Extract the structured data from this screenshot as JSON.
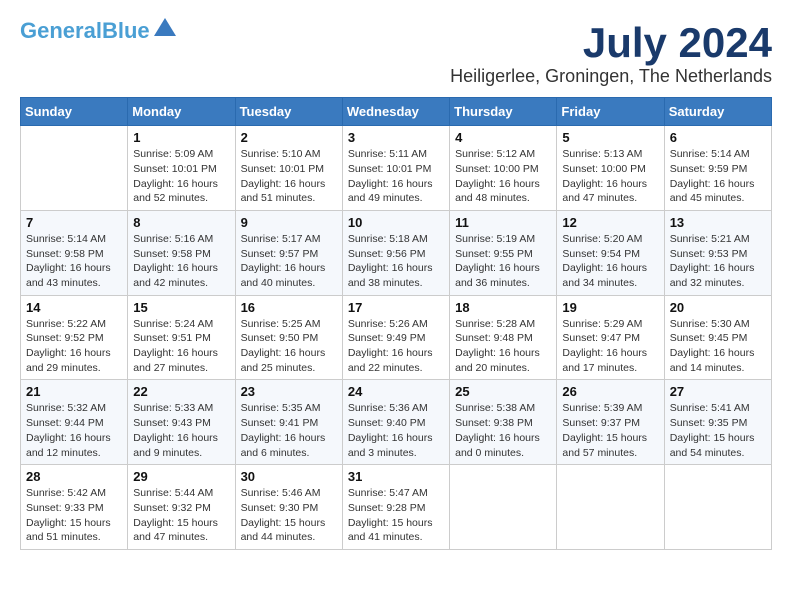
{
  "logo": {
    "line1": "General",
    "line2": "Blue"
  },
  "title": {
    "month": "July 2024",
    "location": "Heiligerlee, Groningen, The Netherlands"
  },
  "header_days": [
    "Sunday",
    "Monday",
    "Tuesday",
    "Wednesday",
    "Thursday",
    "Friday",
    "Saturday"
  ],
  "weeks": [
    [
      {
        "day": "",
        "info": ""
      },
      {
        "day": "1",
        "info": "Sunrise: 5:09 AM\nSunset: 10:01 PM\nDaylight: 16 hours\nand 52 minutes."
      },
      {
        "day": "2",
        "info": "Sunrise: 5:10 AM\nSunset: 10:01 PM\nDaylight: 16 hours\nand 51 minutes."
      },
      {
        "day": "3",
        "info": "Sunrise: 5:11 AM\nSunset: 10:01 PM\nDaylight: 16 hours\nand 49 minutes."
      },
      {
        "day": "4",
        "info": "Sunrise: 5:12 AM\nSunset: 10:00 PM\nDaylight: 16 hours\nand 48 minutes."
      },
      {
        "day": "5",
        "info": "Sunrise: 5:13 AM\nSunset: 10:00 PM\nDaylight: 16 hours\nand 47 minutes."
      },
      {
        "day": "6",
        "info": "Sunrise: 5:14 AM\nSunset: 9:59 PM\nDaylight: 16 hours\nand 45 minutes."
      }
    ],
    [
      {
        "day": "7",
        "info": "Sunrise: 5:14 AM\nSunset: 9:58 PM\nDaylight: 16 hours\nand 43 minutes."
      },
      {
        "day": "8",
        "info": "Sunrise: 5:16 AM\nSunset: 9:58 PM\nDaylight: 16 hours\nand 42 minutes."
      },
      {
        "day": "9",
        "info": "Sunrise: 5:17 AM\nSunset: 9:57 PM\nDaylight: 16 hours\nand 40 minutes."
      },
      {
        "day": "10",
        "info": "Sunrise: 5:18 AM\nSunset: 9:56 PM\nDaylight: 16 hours\nand 38 minutes."
      },
      {
        "day": "11",
        "info": "Sunrise: 5:19 AM\nSunset: 9:55 PM\nDaylight: 16 hours\nand 36 minutes."
      },
      {
        "day": "12",
        "info": "Sunrise: 5:20 AM\nSunset: 9:54 PM\nDaylight: 16 hours\nand 34 minutes."
      },
      {
        "day": "13",
        "info": "Sunrise: 5:21 AM\nSunset: 9:53 PM\nDaylight: 16 hours\nand 32 minutes."
      }
    ],
    [
      {
        "day": "14",
        "info": "Sunrise: 5:22 AM\nSunset: 9:52 PM\nDaylight: 16 hours\nand 29 minutes."
      },
      {
        "day": "15",
        "info": "Sunrise: 5:24 AM\nSunset: 9:51 PM\nDaylight: 16 hours\nand 27 minutes."
      },
      {
        "day": "16",
        "info": "Sunrise: 5:25 AM\nSunset: 9:50 PM\nDaylight: 16 hours\nand 25 minutes."
      },
      {
        "day": "17",
        "info": "Sunrise: 5:26 AM\nSunset: 9:49 PM\nDaylight: 16 hours\nand 22 minutes."
      },
      {
        "day": "18",
        "info": "Sunrise: 5:28 AM\nSunset: 9:48 PM\nDaylight: 16 hours\nand 20 minutes."
      },
      {
        "day": "19",
        "info": "Sunrise: 5:29 AM\nSunset: 9:47 PM\nDaylight: 16 hours\nand 17 minutes."
      },
      {
        "day": "20",
        "info": "Sunrise: 5:30 AM\nSunset: 9:45 PM\nDaylight: 16 hours\nand 14 minutes."
      }
    ],
    [
      {
        "day": "21",
        "info": "Sunrise: 5:32 AM\nSunset: 9:44 PM\nDaylight: 16 hours\nand 12 minutes."
      },
      {
        "day": "22",
        "info": "Sunrise: 5:33 AM\nSunset: 9:43 PM\nDaylight: 16 hours\nand 9 minutes."
      },
      {
        "day": "23",
        "info": "Sunrise: 5:35 AM\nSunset: 9:41 PM\nDaylight: 16 hours\nand 6 minutes."
      },
      {
        "day": "24",
        "info": "Sunrise: 5:36 AM\nSunset: 9:40 PM\nDaylight: 16 hours\nand 3 minutes."
      },
      {
        "day": "25",
        "info": "Sunrise: 5:38 AM\nSunset: 9:38 PM\nDaylight: 16 hours\nand 0 minutes."
      },
      {
        "day": "26",
        "info": "Sunrise: 5:39 AM\nSunset: 9:37 PM\nDaylight: 15 hours\nand 57 minutes."
      },
      {
        "day": "27",
        "info": "Sunrise: 5:41 AM\nSunset: 9:35 PM\nDaylight: 15 hours\nand 54 minutes."
      }
    ],
    [
      {
        "day": "28",
        "info": "Sunrise: 5:42 AM\nSunset: 9:33 PM\nDaylight: 15 hours\nand 51 minutes."
      },
      {
        "day": "29",
        "info": "Sunrise: 5:44 AM\nSunset: 9:32 PM\nDaylight: 15 hours\nand 47 minutes."
      },
      {
        "day": "30",
        "info": "Sunrise: 5:46 AM\nSunset: 9:30 PM\nDaylight: 15 hours\nand 44 minutes."
      },
      {
        "day": "31",
        "info": "Sunrise: 5:47 AM\nSunset: 9:28 PM\nDaylight: 15 hours\nand 41 minutes."
      },
      {
        "day": "",
        "info": ""
      },
      {
        "day": "",
        "info": ""
      },
      {
        "day": "",
        "info": ""
      }
    ]
  ]
}
